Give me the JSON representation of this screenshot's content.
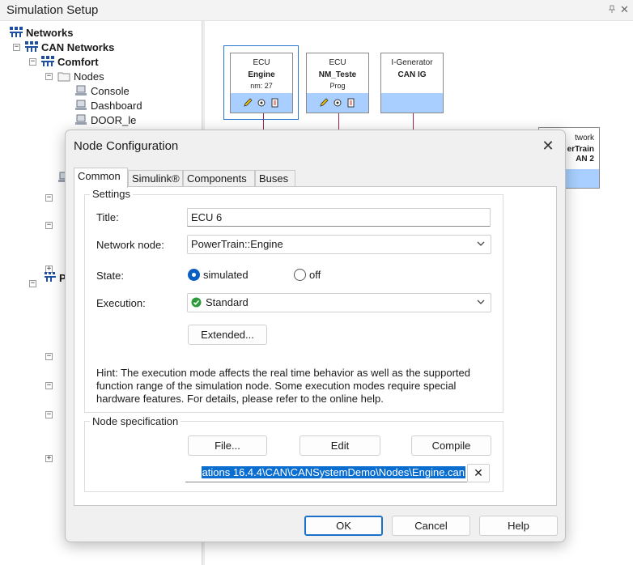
{
  "window": {
    "title": "Simulation Setup",
    "pin_glyph": "ᵖ",
    "close_glyph": "✕"
  },
  "tree": {
    "networks": "Networks",
    "can_networks": "CAN Networks",
    "comfort": "Comfort",
    "nodes": "Nodes",
    "items": [
      "Console",
      "Dashboard",
      "DOOR_le"
    ],
    "expand_plus": "+",
    "expand_minus": "−",
    "partial_letter": "P"
  },
  "diagram": {
    "nodes": [
      {
        "kind": "ECU",
        "name": "Engine",
        "sub": "nm: 27"
      },
      {
        "kind": "ECU",
        "name": "NM_Teste",
        "sub": "Prog"
      },
      {
        "kind": "I-Generator",
        "name": "CAN IG",
        "sub": ""
      }
    ],
    "network_box": {
      "line1": "twork",
      "line2": "erTrain",
      "line3": "AN 2"
    }
  },
  "dialog": {
    "title": "Node Configuration",
    "close": "✕",
    "tabs": [
      "Common",
      "Simulink®",
      "Components",
      "Buses"
    ],
    "active_tab": 0,
    "settings": {
      "group_label": "Settings",
      "title_label": "Title:",
      "title_value": "ECU 6",
      "network_node_label": "Network node:",
      "network_node_value": "PowerTrain::Engine",
      "state_label": "State:",
      "state_options": [
        "simulated",
        "off"
      ],
      "state_selected": "simulated",
      "execution_label": "Execution:",
      "execution_value": "Standard",
      "extended_button": "Extended...",
      "hint_lines": [
        "Hint: The execution mode affects the real time behavior as well as the supported",
        "function range of the simulation node. Some execution modes require special",
        "hardware features. For details, please refer to the online help."
      ]
    },
    "node_spec": {
      "group_label": "Node specification",
      "file_button": "File...",
      "edit_button": "Edit",
      "compile_button": "Compile",
      "file_path": "ations 16.4.4\\CAN\\CANSystemDemo\\Nodes\\Engine.can",
      "clear_button": "✕"
    },
    "buttons": {
      "ok": "OK",
      "cancel": "Cancel",
      "help": "Help"
    }
  },
  "colors": {
    "accent": "#0a6ed1",
    "node_bar": "#a8cfff",
    "wire": "#a3234a",
    "ok_green": "#2e9a3a"
  }
}
